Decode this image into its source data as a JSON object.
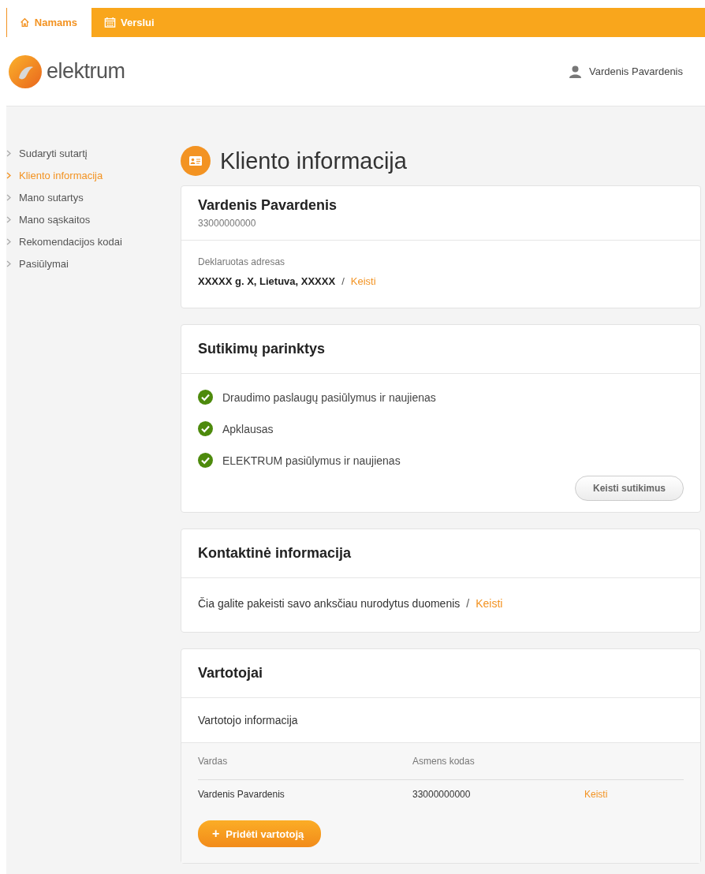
{
  "top_tabs": [
    {
      "label": "Namams",
      "selected": true
    },
    {
      "label": "Verslui",
      "selected": false
    }
  ],
  "logo": {
    "text": "elektrum"
  },
  "user": {
    "name": "Vardenis Pavardenis"
  },
  "sidebar": {
    "items": [
      {
        "label": "Sudaryti sutartį",
        "selected": false
      },
      {
        "label": "Kliento informacija",
        "selected": true
      },
      {
        "label": "Mano sutartys",
        "selected": false
      },
      {
        "label": "Mano sąskaitos",
        "selected": false
      },
      {
        "label": "Rekomendacijos kodai",
        "selected": false
      },
      {
        "label": "Pasiūlymai",
        "selected": false
      }
    ]
  },
  "page_title": "Kliento informacija",
  "client": {
    "name": "Vardenis Pavardenis",
    "code": "33000000000",
    "address_label": "Deklaruotas adresas",
    "address": "XXXXX g. X, Lietuva, XXXXX",
    "separator": "/",
    "edit_link": "Keisti"
  },
  "consents": {
    "title": "Sutikimų parinktys",
    "items": [
      {
        "label": "Draudimo paslaugų pasiūlymus ir naujienas",
        "checked": true
      },
      {
        "label": "Apklausas",
        "checked": true
      },
      {
        "label": "ELEKTRUM pasiūlymus ir naujienas",
        "checked": true
      }
    ],
    "button": "Keisti sutikimus"
  },
  "contact": {
    "title": "Kontaktinė informacija",
    "text": "Čia galite pakeisti savo anksčiau nurodytus duomenis",
    "separator": "/",
    "edit_link": "Keisti"
  },
  "users": {
    "title": "Vartotojai",
    "subtitle": "Vartotojo informacija",
    "columns": [
      "Vardas",
      "Asmens kodas"
    ],
    "rows": [
      {
        "name": "Vardenis Pavardenis",
        "code": "33000000000",
        "edit_link": "Keisti"
      }
    ],
    "add_button": {
      "icon": "+",
      "label": "Pridėti vartotoją"
    }
  }
}
